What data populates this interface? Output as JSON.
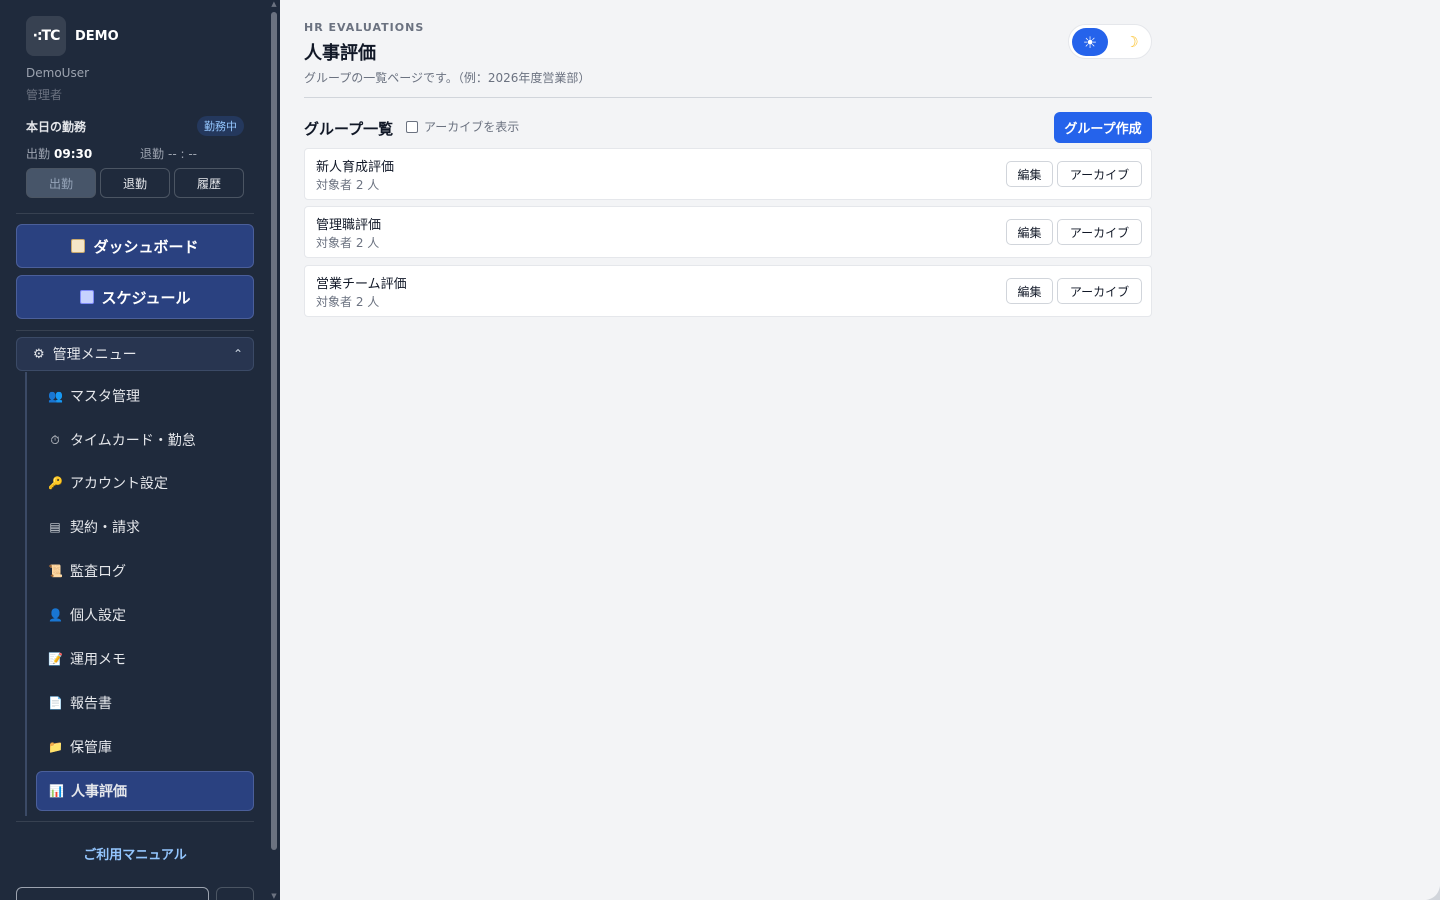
{
  "sidebar": {
    "brand": {
      "logo": "·:TC",
      "name": "DEMO"
    },
    "user": {
      "name": "DemoUser",
      "role": "管理者"
    },
    "attendance": {
      "title": "本日の勤務",
      "status_badge": "勤務中",
      "in_label": "出勤",
      "in_time": "09:30",
      "out_label": "退勤",
      "out_time": "-- : --",
      "buttons": [
        "出勤",
        "退勤",
        "履歴"
      ]
    },
    "primary_nav": [
      {
        "label": "ダッシュボード",
        "icon": "clipboard-icon"
      },
      {
        "label": "スケジュール",
        "icon": "calendar-icon"
      }
    ],
    "admin_menu": {
      "label": "管理メニュー",
      "expanded": true,
      "items": [
        {
          "label": "マスタ管理",
          "icon": "users-icon",
          "glyph": "👥",
          "active": false
        },
        {
          "label": "タイムカード・勤怠",
          "icon": "stopwatch-icon",
          "glyph": "⏱",
          "active": false
        },
        {
          "label": "アカウント設定",
          "icon": "key-icon",
          "glyph": "🔑",
          "active": false
        },
        {
          "label": "契約・請求",
          "icon": "receipt-icon",
          "glyph": "▤",
          "active": false
        },
        {
          "label": "監査ログ",
          "icon": "scroll-icon",
          "glyph": "📜",
          "active": false
        },
        {
          "label": "個人設定",
          "icon": "person-icon",
          "glyph": "👤",
          "active": false
        },
        {
          "label": "運用メモ",
          "icon": "memo-icon",
          "glyph": "📝",
          "active": false
        },
        {
          "label": "報告書",
          "icon": "document-icon",
          "glyph": "📄",
          "active": false
        },
        {
          "label": "保管庫",
          "icon": "folder-icon",
          "glyph": "📁",
          "active": false
        },
        {
          "label": "人事評価",
          "icon": "bar-chart-icon",
          "glyph": "📊",
          "active": true
        }
      ]
    },
    "manual_link": "ご利用マニュアル"
  },
  "main": {
    "eyebrow": "HR EVALUATIONS",
    "title": "人事評価",
    "description": "グループの一覧ページです。（例：2026年度営業部）",
    "theme": {
      "mode": "light",
      "light_icon": "sun-icon",
      "dark_icon": "moon-icon"
    },
    "list_title": "グループ一覧",
    "show_archived_label": "アーカイブを表示",
    "show_archived_checked": false,
    "create_button": "グループ作成",
    "groups": [
      {
        "name": "新人育成評価",
        "count": "対象者 2 人",
        "edit": "編集",
        "archive": "アーカイブ"
      },
      {
        "name": "管理職評価",
        "count": "対象者 2 人",
        "edit": "編集",
        "archive": "アーカイブ"
      },
      {
        "name": "営業チーム評価",
        "count": "対象者 2 人",
        "edit": "編集",
        "archive": "アーカイブ"
      }
    ]
  },
  "colors": {
    "sidebar_bg": "#1f2a3c",
    "nav_active": "#2a4180",
    "accent": "#2563eb",
    "page_bg": "#f3f4f6"
  }
}
